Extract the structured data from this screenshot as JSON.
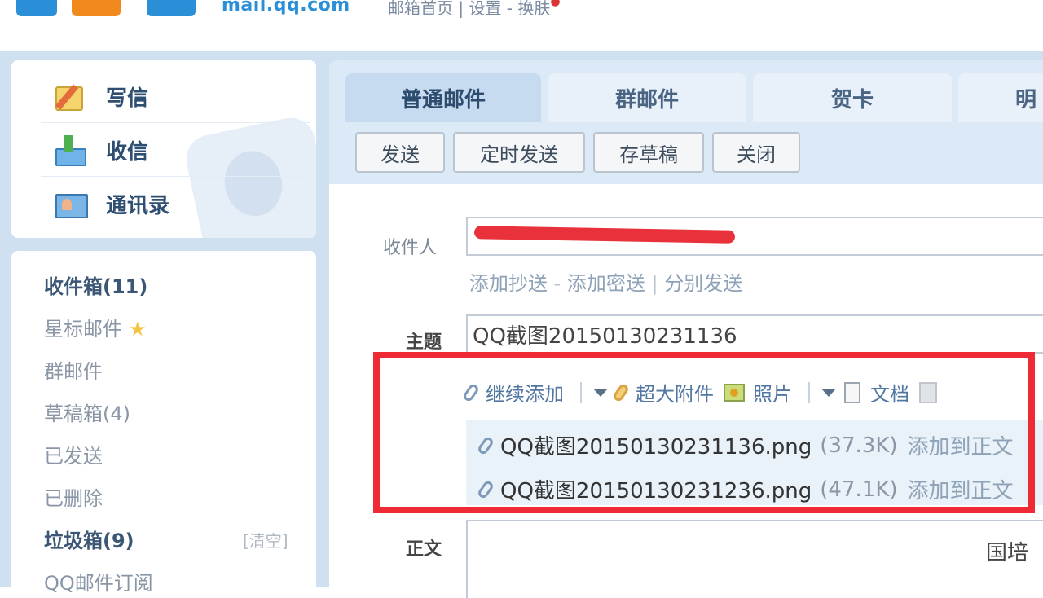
{
  "header": {
    "domain": "mail.qq.com",
    "links": "邮箱首页 | 设置 - 换肤"
  },
  "quick_actions": [
    {
      "label": "写信",
      "icon": "compose-icon"
    },
    {
      "label": "收信",
      "icon": "inbox-download-icon"
    },
    {
      "label": "通讯录",
      "icon": "contacts-icon"
    }
  ],
  "folders": [
    {
      "label": "收件箱(11)"
    },
    {
      "label": "星标邮件"
    },
    {
      "label": "群邮件"
    },
    {
      "label": "草稿箱(4)"
    },
    {
      "label": "已发送"
    },
    {
      "label": "已删除"
    },
    {
      "label": "垃圾箱(9)"
    },
    {
      "label": "QQ邮件订阅"
    }
  ],
  "folder_clear": "[清空]",
  "tabs": [
    "普通邮件",
    "群邮件",
    "贺卡",
    "明"
  ],
  "buttons": [
    "发送",
    "定时发送",
    "存草稿",
    "关闭"
  ],
  "compose": {
    "to_label": "收件人",
    "cc_add": "添加抄送",
    "bcc_add": "添加密送",
    "separate_send": "分别发送",
    "subject_label": "主题",
    "subject_value": "QQ截图20150130231136",
    "body_label": "正文",
    "body_text": "国培"
  },
  "attach_toolbar": {
    "continue_add": "继续添加",
    "large_attach": "超大附件",
    "photo": "照片",
    "document": "文档"
  },
  "attachments": [
    {
      "name": "QQ截图20150130231136.png",
      "size": "(37.3K)",
      "action": "添加到正文"
    },
    {
      "name": "QQ截图20150130231236.png",
      "size": "(47.1K)",
      "action": "添加到正文"
    }
  ],
  "colors": {
    "accent": "#2b8fd8",
    "highlight_border": "#ee2a35",
    "frame": "#cfe0f1"
  }
}
